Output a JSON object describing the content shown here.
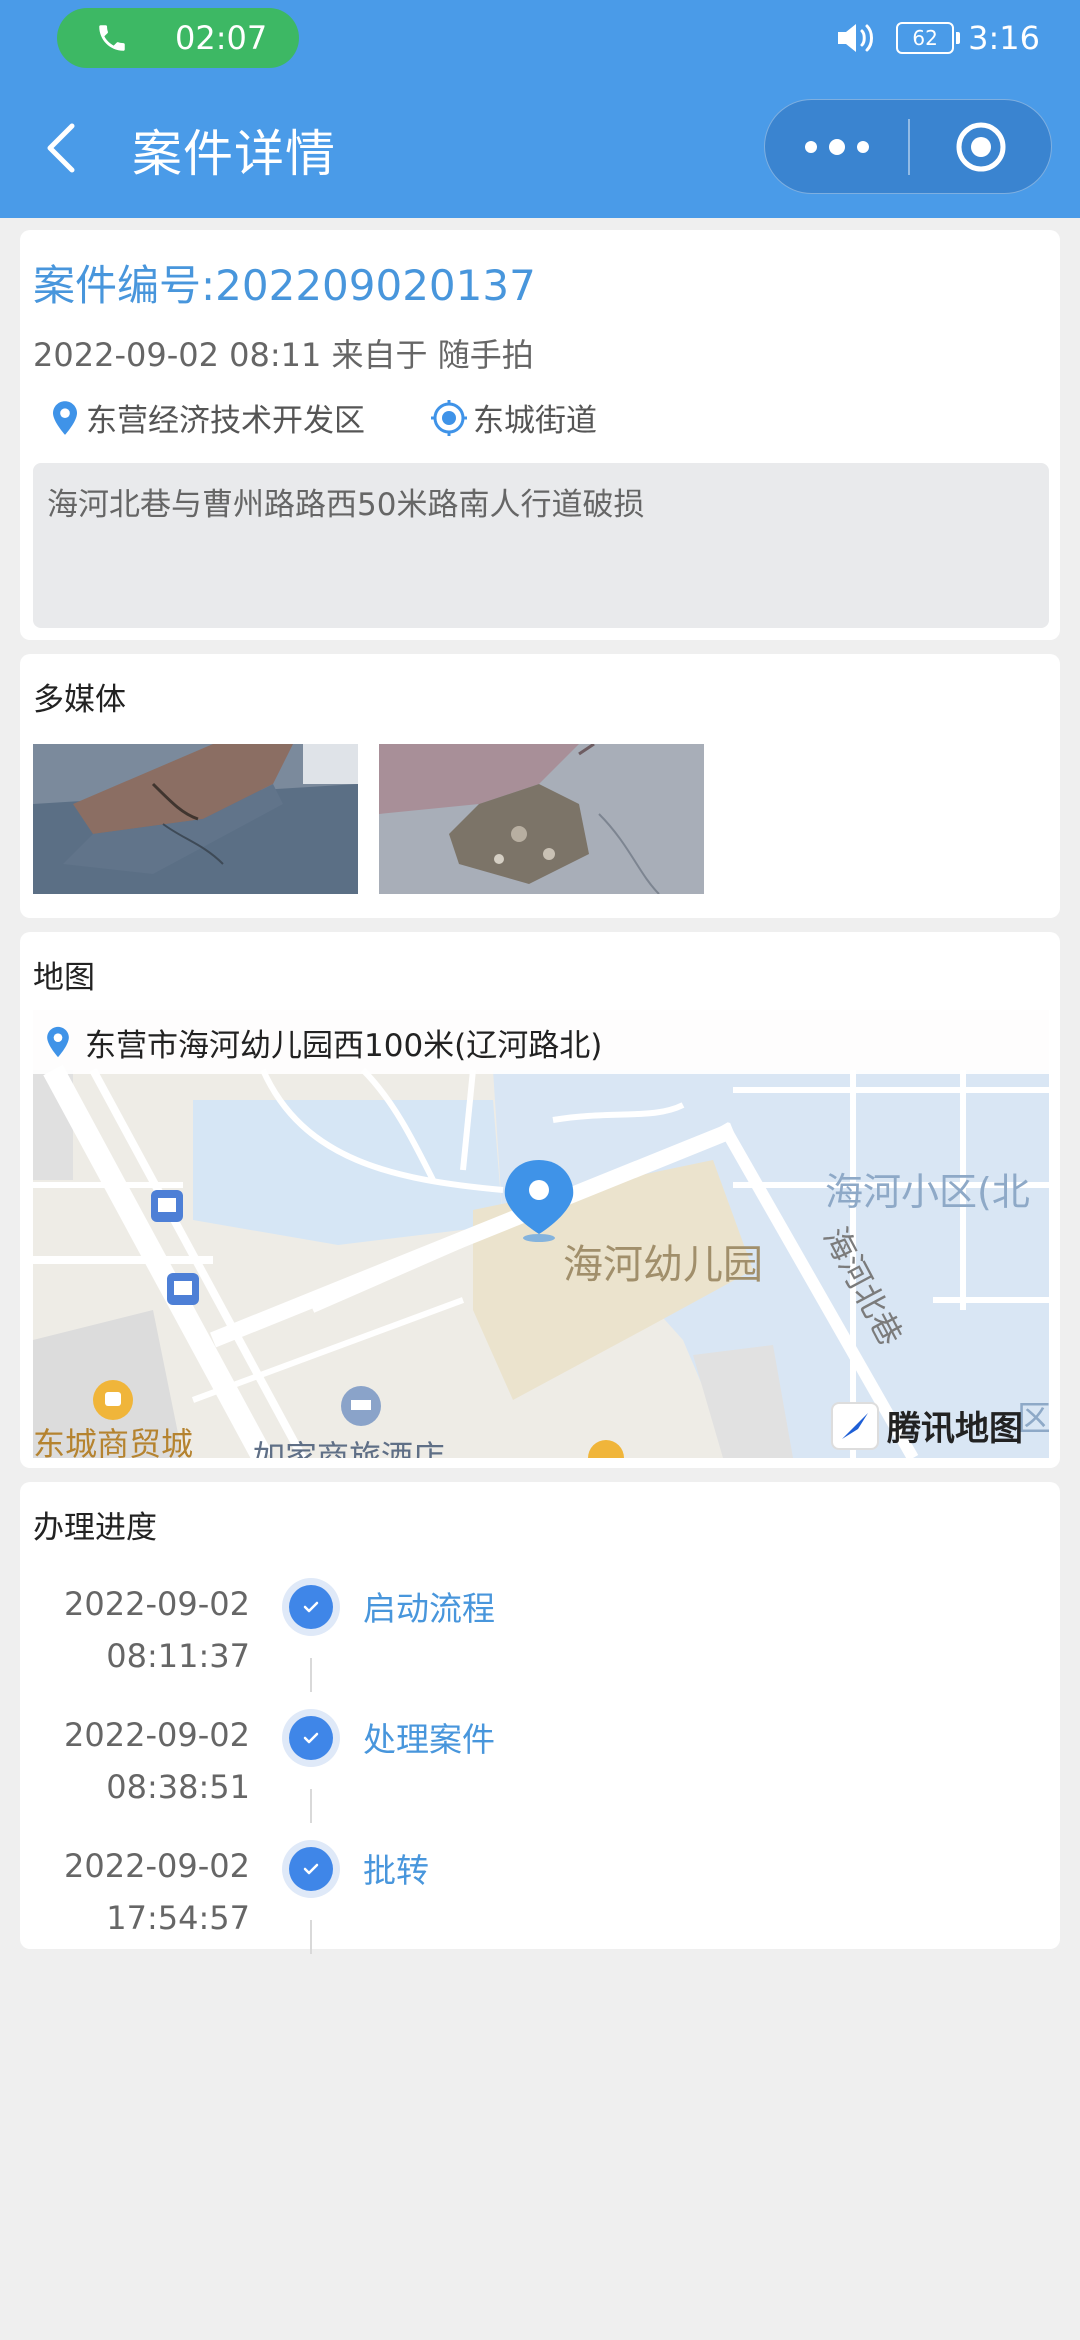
{
  "status_bar": {
    "call_timer": "02:07",
    "battery": "62",
    "time": "3:16"
  },
  "nav": {
    "title": "案件详情"
  },
  "case": {
    "number_label": "案件编号:202209020137",
    "meta": "2022-09-02 08:11 来自于 随手拍",
    "district": "东营经济技术开发区",
    "street": "东城街道",
    "description": "海河北巷与曹州路路西50米路南人行道破损"
  },
  "media": {
    "title": "多媒体"
  },
  "map": {
    "title": "地图",
    "address": "东营市海河幼儿园西100米(辽河路北)",
    "labels": {
      "kindergarten": "海河幼儿园",
      "community": "海河小区(北",
      "lane": "海河北巷",
      "mall": "东城商贸城",
      "hotel": "如家商旅酒店",
      "district_r": "区"
    },
    "logo": "腾讯地图"
  },
  "progress": {
    "title": "办理进度",
    "items": [
      {
        "date": "2022-09-02",
        "time": "08:11:37",
        "label": "启动流程"
      },
      {
        "date": "2022-09-02",
        "time": "08:38:51",
        "label": "处理案件"
      },
      {
        "date": "2022-09-02",
        "time": "17:54:57",
        "label": "批转"
      }
    ]
  },
  "colors": {
    "header": "#4a9be8",
    "accent": "#4896dc",
    "call_pill": "#3db864",
    "timeline_dot": "#3f86e8"
  }
}
